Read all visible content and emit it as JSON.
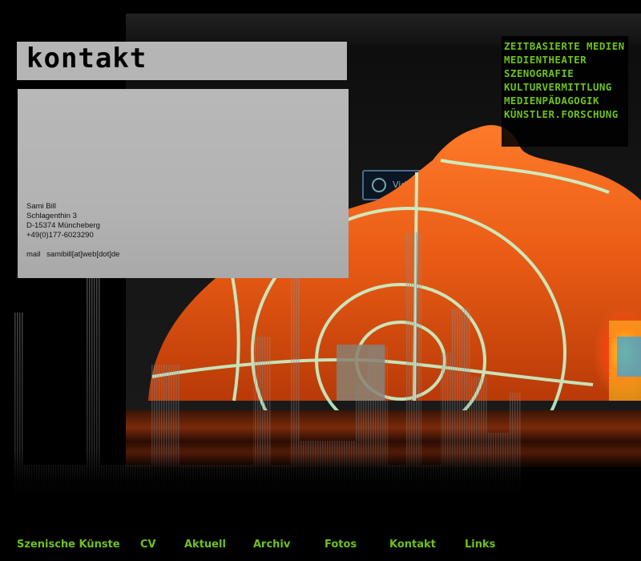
{
  "title": "kontakt",
  "contact": {
    "name": "Sami Bill",
    "street": "Schlagenthin 3",
    "city": "D-15374 Müncheberg",
    "phone": "+49(0)177-6023290",
    "mail_label": "mail",
    "mail_value": "samibill[at]web[dot]de"
  },
  "categories": [
    "ZEITBASIERTE MEDIEN",
    "MEDIENTHEATER",
    "SZENOGRAFIE",
    "KULTURVERMITTLUNG",
    "MEDIENPÄDAGOGIK",
    "KÜNSTLER.FORSCHUNG"
  ],
  "nav": [
    "Szenische Künste",
    "CV",
    "Aktuell",
    "Archiv",
    "Fotos",
    "Kontakt",
    "Links"
  ],
  "colors": {
    "accent_green": "#6ec21a",
    "panel_grey": "#b5b5b5",
    "background": "#000000"
  },
  "photo": {
    "screen_label": "Vid"
  }
}
